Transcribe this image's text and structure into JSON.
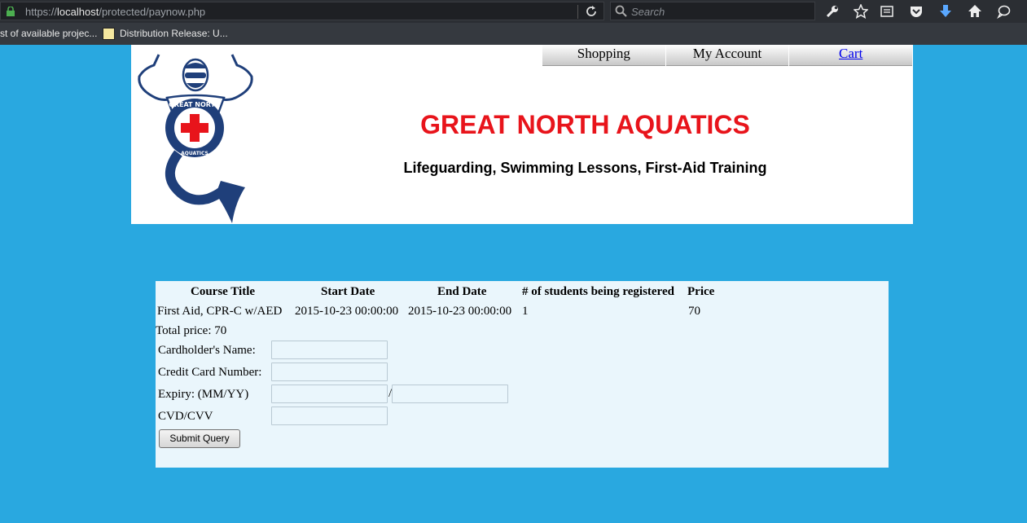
{
  "browser": {
    "url_scheme": "https://",
    "url_host": "localhost",
    "url_path": "/protected/paynow.php",
    "search_placeholder": "Search",
    "bookmarks": [
      "st of available projec...",
      "Distribution Release: U..."
    ]
  },
  "nav": {
    "items": [
      "Shopping",
      "My Account",
      "Cart"
    ]
  },
  "header": {
    "title": "GREAT NORTH AQUATICS",
    "tagline": "Lifeguarding, Swimming Lessons, First-Aid Training",
    "logo_text_top": "GREAT NORTH",
    "logo_text_bottom": "AQUATICS"
  },
  "table": {
    "headers": [
      "Course Title",
      "Start Date",
      "End Date",
      "# of students being registered",
      "Price"
    ],
    "rows": [
      [
        "First Aid, CPR-C w/AED",
        "2015-10-23 00:00:00",
        "2015-10-23 00:00:00",
        "1",
        "70"
      ]
    ]
  },
  "total": "Total price: 70",
  "form": {
    "cardholder_label": "Cardholder's Name:",
    "card_number_label": "Credit Card Number:",
    "expiry_label": "Expiry: (MM/YY)",
    "expiry_separator": "/",
    "cvv_label": "CVD/CVV",
    "submit_label": "Submit Query"
  },
  "colors": {
    "page_bg": "#29a8e0",
    "panel_bg": "#eaf6fc",
    "title_red": "#e8141b"
  }
}
